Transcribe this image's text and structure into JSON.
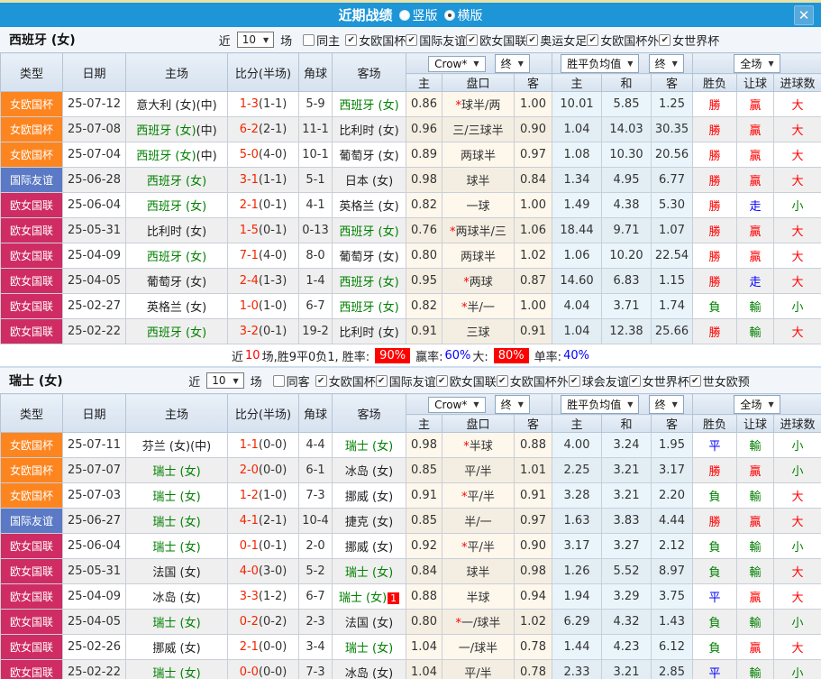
{
  "titlebar": {
    "title": "近期战绩",
    "vertical_label": "竖版",
    "horizontal_label": "横版",
    "selected_mode": "横版"
  },
  "icons": {
    "dropdown_arrow": "▼",
    "close": "✕",
    "checkmark": "✔"
  },
  "colors": {
    "topbar_blue": "#1d95d6",
    "league_orange": "#fd8520",
    "league_blue": "#5b79c4",
    "league_crimson": "#cf2c63",
    "team_green": "#008000",
    "score_red": "#f32500",
    "win_red": "#ff0000",
    "draw_blue": "#0000ff",
    "lose_green": "#008000",
    "rate_badge_red": "#ff0000"
  },
  "filter_labels": {
    "recent": "近",
    "count": "10",
    "games": "场"
  },
  "table_headers": {
    "type": "类型",
    "date": "日期",
    "home": "主场",
    "score": "比分(半场)",
    "corner": "角球",
    "away": "客场",
    "crow_dropdown": "Crow*",
    "final_dropdown": "终",
    "wdl_dropdown": "胜平负均值",
    "fulltime_dropdown": "全场",
    "home_odds": "主",
    "handicap": "盘口",
    "away_odds": "客",
    "avg_home": "主",
    "avg_draw": "和",
    "avg_away": "客",
    "result": "胜负",
    "handicap_result": "让球",
    "goals": "进球数"
  },
  "labels": {
    "mid": "(中)"
  },
  "sections": [
    {
      "team": "西班牙 (女)",
      "same_label": "同主",
      "same_checked": false,
      "leagues": [
        "女欧国杯",
        "国际友谊",
        "欧女国联",
        "奥运女足",
        "女欧国杯外",
        "女世界杯"
      ],
      "rows": [
        {
          "league": "女欧国杯",
          "lg": "orange",
          "date": "25-07-12",
          "home": "意大利 (女)",
          "home_mid": true,
          "home_green": false,
          "score": "1-3",
          "half": "(1-1)",
          "corner": "5-9",
          "away": "西班牙 (女)",
          "away_green": true,
          "o1": "0.86",
          "hc": "球半/两",
          "hc_star": true,
          "o2": "1.00",
          "a1": "10.01",
          "a2": "5.85",
          "a3": "1.25",
          "r1": "勝",
          "c1": "red",
          "r2": "贏",
          "c2": "red",
          "r3": "大",
          "c3": "red"
        },
        {
          "league": "女欧国杯",
          "lg": "orange",
          "date": "25-07-08",
          "home": "西班牙 (女)",
          "home_mid": true,
          "home_green": true,
          "score": "6-2",
          "half": "(2-1)",
          "corner": "11-1",
          "away": "比利时 (女)",
          "away_green": false,
          "o1": "0.96",
          "hc": "三/三球半",
          "hc_star": false,
          "o2": "0.90",
          "a1": "1.04",
          "a2": "14.03",
          "a3": "30.35",
          "r1": "勝",
          "c1": "red",
          "r2": "贏",
          "c2": "red",
          "r3": "大",
          "c3": "red"
        },
        {
          "league": "女欧国杯",
          "lg": "orange",
          "date": "25-07-04",
          "home": "西班牙 (女)",
          "home_mid": true,
          "home_green": true,
          "score": "5-0",
          "half": "(4-0)",
          "corner": "10-1",
          "away": "葡萄牙 (女)",
          "away_green": false,
          "o1": "0.89",
          "hc": "两球半",
          "hc_star": false,
          "o2": "0.97",
          "a1": "1.08",
          "a2": "10.30",
          "a3": "20.56",
          "r1": "勝",
          "c1": "red",
          "r2": "贏",
          "c2": "red",
          "r3": "大",
          "c3": "red"
        },
        {
          "league": "国际友谊",
          "lg": "blue",
          "date": "25-06-28",
          "home": "西班牙 (女)",
          "home_mid": false,
          "home_green": true,
          "score": "3-1",
          "half": "(1-1)",
          "corner": "5-1",
          "away": "日本 (女)",
          "away_green": false,
          "o1": "0.98",
          "hc": "球半",
          "hc_star": false,
          "o2": "0.84",
          "a1": "1.34",
          "a2": "4.95",
          "a3": "6.77",
          "r1": "勝",
          "c1": "red",
          "r2": "贏",
          "c2": "red",
          "r3": "大",
          "c3": "red"
        },
        {
          "league": "欧女国联",
          "lg": "crimson",
          "date": "25-06-04",
          "home": "西班牙 (女)",
          "home_mid": false,
          "home_green": true,
          "score": "2-1",
          "half": "(0-1)",
          "corner": "4-1",
          "away": "英格兰 (女)",
          "away_green": false,
          "o1": "0.82",
          "hc": "一球",
          "hc_star": false,
          "o2": "1.00",
          "a1": "1.49",
          "a2": "4.38",
          "a3": "5.30",
          "r1": "勝",
          "c1": "red",
          "r2": "走",
          "c2": "blue",
          "r3": "小",
          "c3": "green"
        },
        {
          "league": "欧女国联",
          "lg": "crimson",
          "date": "25-05-31",
          "home": "比利时 (女)",
          "home_mid": false,
          "home_green": false,
          "score": "1-5",
          "half": "(0-1)",
          "corner": "0-13",
          "away": "西班牙 (女)",
          "away_green": true,
          "o1": "0.76",
          "hc": "两球半/三",
          "hc_star": true,
          "o2": "1.06",
          "a1": "18.44",
          "a2": "9.71",
          "a3": "1.07",
          "r1": "勝",
          "c1": "red",
          "r2": "贏",
          "c2": "red",
          "r3": "大",
          "c3": "red"
        },
        {
          "league": "欧女国联",
          "lg": "crimson",
          "date": "25-04-09",
          "home": "西班牙 (女)",
          "home_mid": false,
          "home_green": true,
          "score": "7-1",
          "half": "(4-0)",
          "corner": "8-0",
          "away": "葡萄牙 (女)",
          "away_green": false,
          "o1": "0.80",
          "hc": "两球半",
          "hc_star": false,
          "o2": "1.02",
          "a1": "1.06",
          "a2": "10.20",
          "a3": "22.54",
          "r1": "勝",
          "c1": "red",
          "r2": "贏",
          "c2": "red",
          "r3": "大",
          "c3": "red"
        },
        {
          "league": "欧女国联",
          "lg": "crimson",
          "date": "25-04-05",
          "home": "葡萄牙 (女)",
          "home_mid": false,
          "home_green": false,
          "score": "2-4",
          "half": "(1-3)",
          "corner": "1-4",
          "away": "西班牙 (女)",
          "away_green": true,
          "o1": "0.95",
          "hc": "两球",
          "hc_star": true,
          "o2": "0.87",
          "a1": "14.60",
          "a2": "6.83",
          "a3": "1.15",
          "r1": "勝",
          "c1": "red",
          "r2": "走",
          "c2": "blue",
          "r3": "大",
          "c3": "red"
        },
        {
          "league": "欧女国联",
          "lg": "crimson",
          "date": "25-02-27",
          "home": "英格兰 (女)",
          "home_mid": false,
          "home_green": false,
          "score": "1-0",
          "half": "(1-0)",
          "corner": "6-7",
          "away": "西班牙 (女)",
          "away_green": true,
          "o1": "0.82",
          "hc": "半/一",
          "hc_star": true,
          "o2": "1.00",
          "a1": "4.04",
          "a2": "3.71",
          "a3": "1.74",
          "r1": "負",
          "c1": "green",
          "r2": "輸",
          "c2": "green",
          "r3": "小",
          "c3": "green"
        },
        {
          "league": "欧女国联",
          "lg": "crimson",
          "date": "25-02-22",
          "home": "西班牙 (女)",
          "home_mid": false,
          "home_green": true,
          "score": "3-2",
          "half": "(0-1)",
          "corner": "19-2",
          "away": "比利时 (女)",
          "away_green": false,
          "o1": "0.91",
          "hc": "三球",
          "hc_star": false,
          "o2": "0.91",
          "a1": "1.04",
          "a2": "12.38",
          "a3": "25.66",
          "r1": "勝",
          "c1": "red",
          "r2": "輸",
          "c2": "green",
          "r3": "大",
          "c3": "red"
        }
      ],
      "summary": [
        {
          "text": "近",
          "style": "plain"
        },
        {
          "text": "10",
          "style": "red"
        },
        {
          "text": "场,胜9平0负1, 胜率:",
          "style": "plain"
        },
        {
          "text": "90%",
          "style": "badge"
        },
        {
          "text": "赢率:",
          "style": "plain"
        },
        {
          "text": "60%",
          "style": "blue"
        },
        {
          "text": " 大:",
          "style": "plain"
        },
        {
          "text": "80%",
          "style": "badge"
        },
        {
          "text": "单率:",
          "style": "plain"
        },
        {
          "text": "40%",
          "style": "blue"
        }
      ]
    },
    {
      "team": "瑞士 (女)",
      "same_label": "同客",
      "same_checked": false,
      "leagues": [
        "女欧国杯",
        "国际友谊",
        "欧女国联",
        "女欧国杯外",
        "球会友谊",
        "女世界杯",
        "世女欧预"
      ],
      "rows": [
        {
          "league": "女欧国杯",
          "lg": "orange",
          "date": "25-07-11",
          "home": "芬兰 (女)",
          "home_mid": true,
          "home_green": false,
          "score": "1-1",
          "half": "(0-0)",
          "corner": "4-4",
          "away": "瑞士 (女)",
          "away_green": true,
          "o1": "0.98",
          "hc": "半球",
          "hc_star": true,
          "o2": "0.88",
          "a1": "4.00",
          "a2": "3.24",
          "a3": "1.95",
          "r1": "平",
          "c1": "blue",
          "r2": "輸",
          "c2": "green",
          "r3": "小",
          "c3": "green"
        },
        {
          "league": "女欧国杯",
          "lg": "orange",
          "date": "25-07-07",
          "home": "瑞士 (女)",
          "home_mid": false,
          "home_green": true,
          "score": "2-0",
          "half": "(0-0)",
          "corner": "6-1",
          "away": "冰岛 (女)",
          "away_green": false,
          "o1": "0.85",
          "hc": "平/半",
          "hc_star": false,
          "o2": "1.01",
          "a1": "2.25",
          "a2": "3.21",
          "a3": "3.17",
          "r1": "勝",
          "c1": "red",
          "r2": "贏",
          "c2": "red",
          "r3": "小",
          "c3": "green"
        },
        {
          "league": "女欧国杯",
          "lg": "orange",
          "date": "25-07-03",
          "home": "瑞士 (女)",
          "home_mid": false,
          "home_green": true,
          "score": "1-2",
          "half": "(1-0)",
          "corner": "7-3",
          "away": "挪威 (女)",
          "away_green": false,
          "o1": "0.91",
          "hc": "平/半",
          "hc_star": true,
          "o2": "0.91",
          "a1": "3.28",
          "a2": "3.21",
          "a3": "2.20",
          "r1": "負",
          "c1": "green",
          "r2": "輸",
          "c2": "green",
          "r3": "大",
          "c3": "red"
        },
        {
          "league": "国际友谊",
          "lg": "blue",
          "date": "25-06-27",
          "home": "瑞士 (女)",
          "home_mid": false,
          "home_green": true,
          "score": "4-1",
          "half": "(2-1)",
          "corner": "10-4",
          "away": "捷克 (女)",
          "away_green": false,
          "o1": "0.85",
          "hc": "半/一",
          "hc_star": false,
          "o2": "0.97",
          "a1": "1.63",
          "a2": "3.83",
          "a3": "4.44",
          "r1": "勝",
          "c1": "red",
          "r2": "贏",
          "c2": "red",
          "r3": "大",
          "c3": "red"
        },
        {
          "league": "欧女国联",
          "lg": "crimson",
          "date": "25-06-04",
          "home": "瑞士 (女)",
          "home_mid": false,
          "home_green": true,
          "score": "0-1",
          "half": "(0-1)",
          "corner": "2-0",
          "away": "挪威 (女)",
          "away_green": false,
          "o1": "0.92",
          "hc": "平/半",
          "hc_star": true,
          "o2": "0.90",
          "a1": "3.17",
          "a2": "3.27",
          "a3": "2.12",
          "r1": "負",
          "c1": "green",
          "r2": "輸",
          "c2": "green",
          "r3": "小",
          "c3": "green"
        },
        {
          "league": "欧女国联",
          "lg": "crimson",
          "date": "25-05-31",
          "home": "法国 (女)",
          "home_mid": false,
          "home_green": false,
          "score": "4-0",
          "half": "(3-0)",
          "corner": "5-2",
          "away": "瑞士 (女)",
          "away_green": true,
          "o1": "0.84",
          "hc": "球半",
          "hc_star": false,
          "o2": "0.98",
          "a1": "1.26",
          "a2": "5.52",
          "a3": "8.97",
          "r1": "負",
          "c1": "green",
          "r2": "輸",
          "c2": "green",
          "r3": "大",
          "c3": "red"
        },
        {
          "league": "欧女国联",
          "lg": "crimson",
          "date": "25-04-09",
          "home": "冰岛 (女)",
          "home_mid": false,
          "home_green": false,
          "score": "3-3",
          "half": "(1-2)",
          "corner": "6-7",
          "away": "瑞士 (女)",
          "away_green": true,
          "away_badge": "1",
          "o1": "0.88",
          "hc": "半球",
          "hc_star": false,
          "o2": "0.94",
          "a1": "1.94",
          "a2": "3.29",
          "a3": "3.75",
          "r1": "平",
          "c1": "blue",
          "r2": "贏",
          "c2": "red",
          "r3": "大",
          "c3": "red"
        },
        {
          "league": "欧女国联",
          "lg": "crimson",
          "date": "25-04-05",
          "home": "瑞士 (女)",
          "home_mid": false,
          "home_green": true,
          "score": "0-2",
          "half": "(0-2)",
          "corner": "2-3",
          "away": "法国 (女)",
          "away_green": false,
          "o1": "0.80",
          "hc": "一/球半",
          "hc_star": true,
          "o2": "1.02",
          "a1": "6.29",
          "a2": "4.32",
          "a3": "1.43",
          "r1": "負",
          "c1": "green",
          "r2": "輸",
          "c2": "green",
          "r3": "小",
          "c3": "green"
        },
        {
          "league": "欧女国联",
          "lg": "crimson",
          "date": "25-02-26",
          "home": "挪威 (女)",
          "home_mid": false,
          "home_green": false,
          "score": "2-1",
          "half": "(0-0)",
          "corner": "3-4",
          "away": "瑞士 (女)",
          "away_green": true,
          "o1": "1.04",
          "hc": "一/球半",
          "hc_star": false,
          "o2": "0.78",
          "a1": "1.44",
          "a2": "4.23",
          "a3": "6.12",
          "r1": "負",
          "c1": "green",
          "r2": "贏",
          "c2": "red",
          "r3": "大",
          "c3": "red"
        },
        {
          "league": "欧女国联",
          "lg": "crimson",
          "date": "25-02-22",
          "home": "瑞士 (女)",
          "home_mid": false,
          "home_green": true,
          "score": "0-0",
          "half": "(0-0)",
          "corner": "7-3",
          "away": "冰岛 (女)",
          "away_green": false,
          "o1": "1.04",
          "hc": "平/半",
          "hc_star": false,
          "o2": "0.78",
          "a1": "2.33",
          "a2": "3.21",
          "a3": "2.85",
          "r1": "平",
          "c1": "blue",
          "r2": "輸",
          "c2": "green",
          "r3": "小",
          "c3": "green"
        }
      ]
    }
  ]
}
